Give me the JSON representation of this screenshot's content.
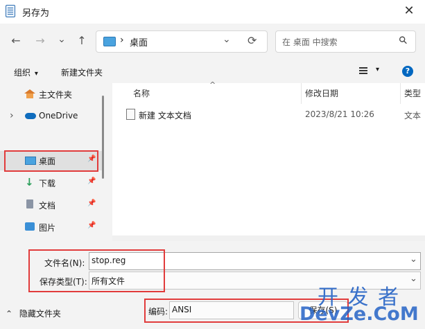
{
  "window": {
    "title": "另存为",
    "close_glyph": "✕"
  },
  "nav": {
    "back": "←",
    "forward": "→",
    "recent": "⌄",
    "up": "↑",
    "refresh": "⟳"
  },
  "address": {
    "separator": "›",
    "current": "桌面",
    "dropdown": "⌄"
  },
  "search": {
    "placeholder": "在 桌面 中搜索",
    "icon": "⚲"
  },
  "toolbar": {
    "organize": "组织",
    "organize_arrow": "▾",
    "new_folder": "新建文件夹",
    "view_arrow": "▾",
    "help": "?"
  },
  "sidebar": {
    "items": [
      {
        "label": "主文件夹",
        "icon": "home-icon"
      },
      {
        "label": "OneDrive",
        "icon": "cloud-icon",
        "expand": "›"
      },
      {
        "label": "桌面",
        "icon": "desktop-icon",
        "pin": "📌"
      },
      {
        "label": "下载",
        "icon": "download-icon",
        "pin": "📌"
      },
      {
        "label": "文档",
        "icon": "document-icon",
        "pin": "📌"
      },
      {
        "label": "图片",
        "icon": "picture-icon",
        "pin": "📌"
      }
    ]
  },
  "filelist": {
    "columns": [
      "名称",
      "修改日期",
      "类型"
    ],
    "sort_indicator": "^",
    "rows": [
      {
        "name": "新建 文本文档",
        "date": "2023/8/21 10:26",
        "type": "文本"
      }
    ]
  },
  "form": {
    "filename_label": "文件名(N):",
    "filename_value": "stop.reg",
    "filetype_label": "保存类型(T):",
    "filetype_value": "所有文件",
    "encoding_label": "编码:",
    "encoding_value": "ANSI",
    "dropdown": "⌄"
  },
  "footer": {
    "hide_folders": "隐藏文件夹",
    "hide_arrow": "⌃",
    "save_button": "保存(S)"
  },
  "watermark": {
    "top": "开 发 者",
    "bottom": "DevZe.CoM"
  },
  "colors": {
    "highlight": "#e13b3b",
    "accent": "#0067c0"
  }
}
